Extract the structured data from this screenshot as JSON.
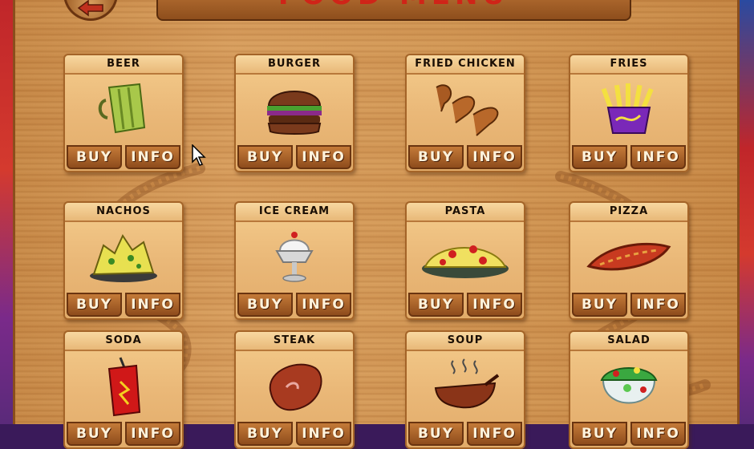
{
  "title": "FOOD MENU",
  "back_icon": "back-arrow-icon",
  "buy_label": "BUY",
  "info_label": "INFO",
  "colors": {
    "title_red": "#d02418",
    "wood": "#d9a060",
    "button": "#b46e32"
  },
  "items": [
    {
      "name": "BEER",
      "icon": "beer-icon"
    },
    {
      "name": "BURGER",
      "icon": "burger-icon"
    },
    {
      "name": "FRIED CHICKEN",
      "icon": "fried-chicken-icon"
    },
    {
      "name": "FRIES",
      "icon": "fries-icon"
    },
    {
      "name": "NACHOS",
      "icon": "nachos-icon"
    },
    {
      "name": "ICE CREAM",
      "icon": "ice-cream-icon"
    },
    {
      "name": "PASTA",
      "icon": "pasta-icon"
    },
    {
      "name": "PIZZA",
      "icon": "pizza-icon"
    },
    {
      "name": "SODA",
      "icon": "soda-icon"
    },
    {
      "name": "STEAK",
      "icon": "steak-icon"
    },
    {
      "name": "SOUP",
      "icon": "soup-icon"
    },
    {
      "name": "SALAD",
      "icon": "salad-icon"
    }
  ]
}
